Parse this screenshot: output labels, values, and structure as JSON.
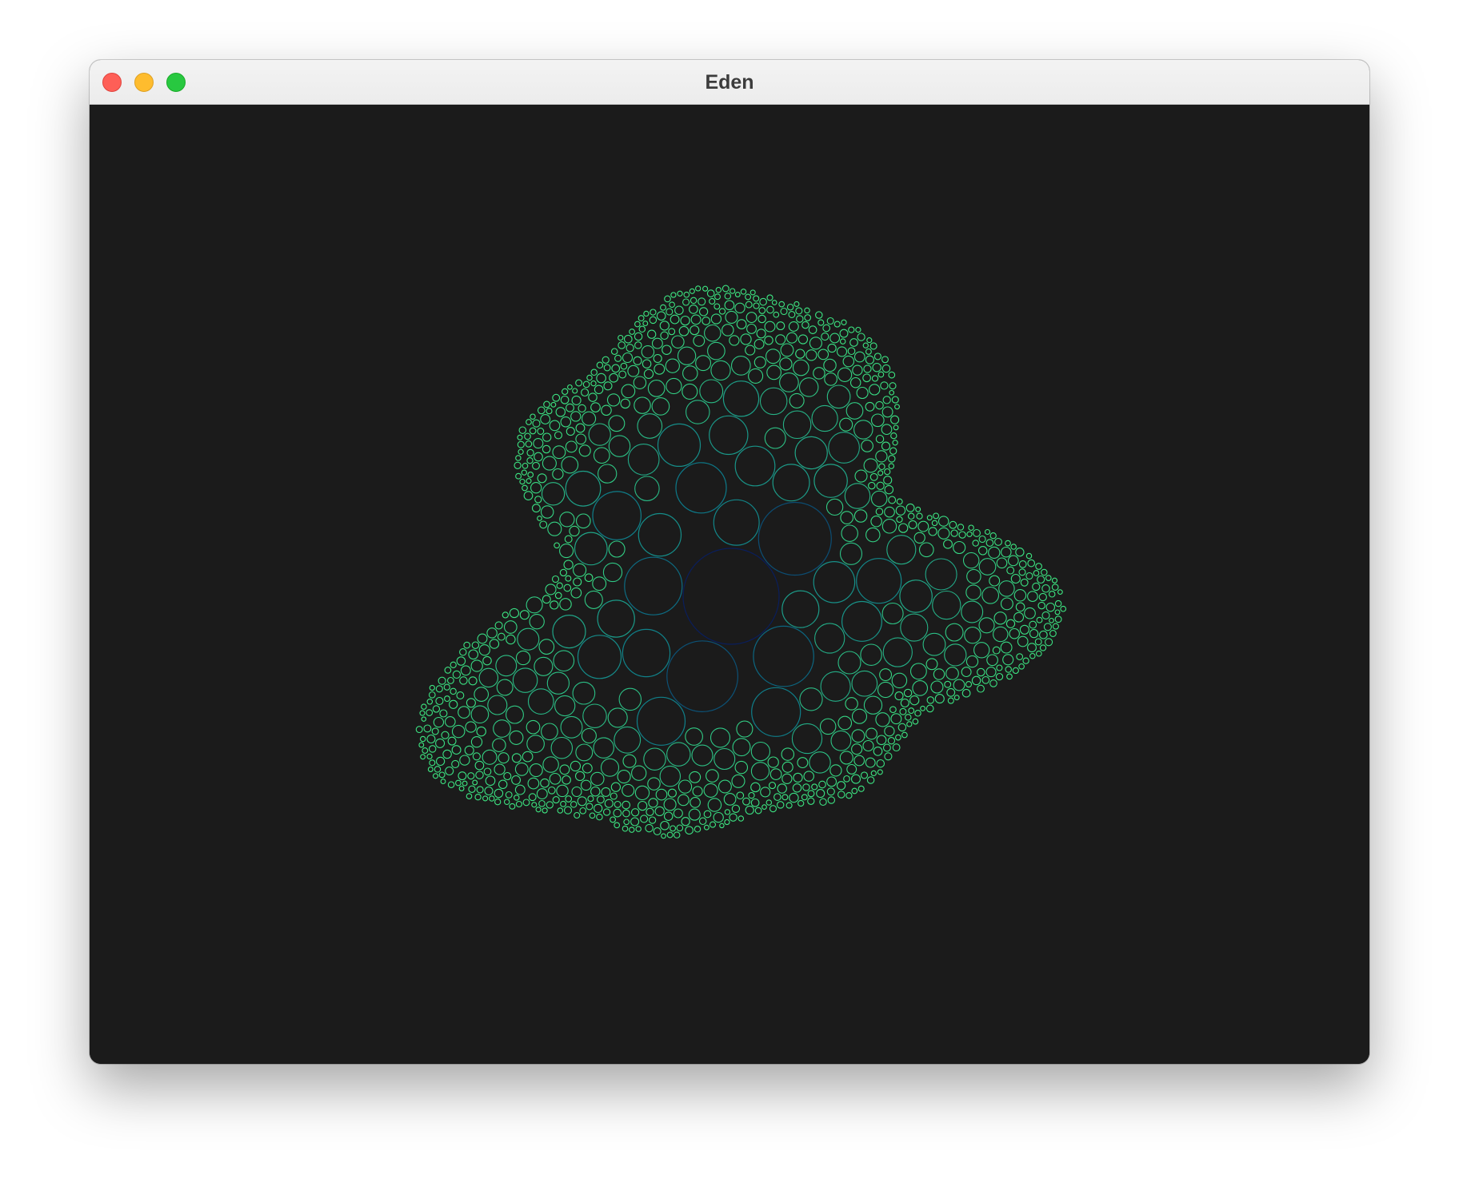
{
  "window": {
    "title": "Eden",
    "buttons": [
      "close",
      "minimize",
      "zoom"
    ]
  },
  "canvas": {
    "background": "#1b1b1b",
    "description_colors": {
      "center": "#0a1e5c",
      "mid": "#0d7a8a",
      "edge": "#3ee882"
    }
  }
}
